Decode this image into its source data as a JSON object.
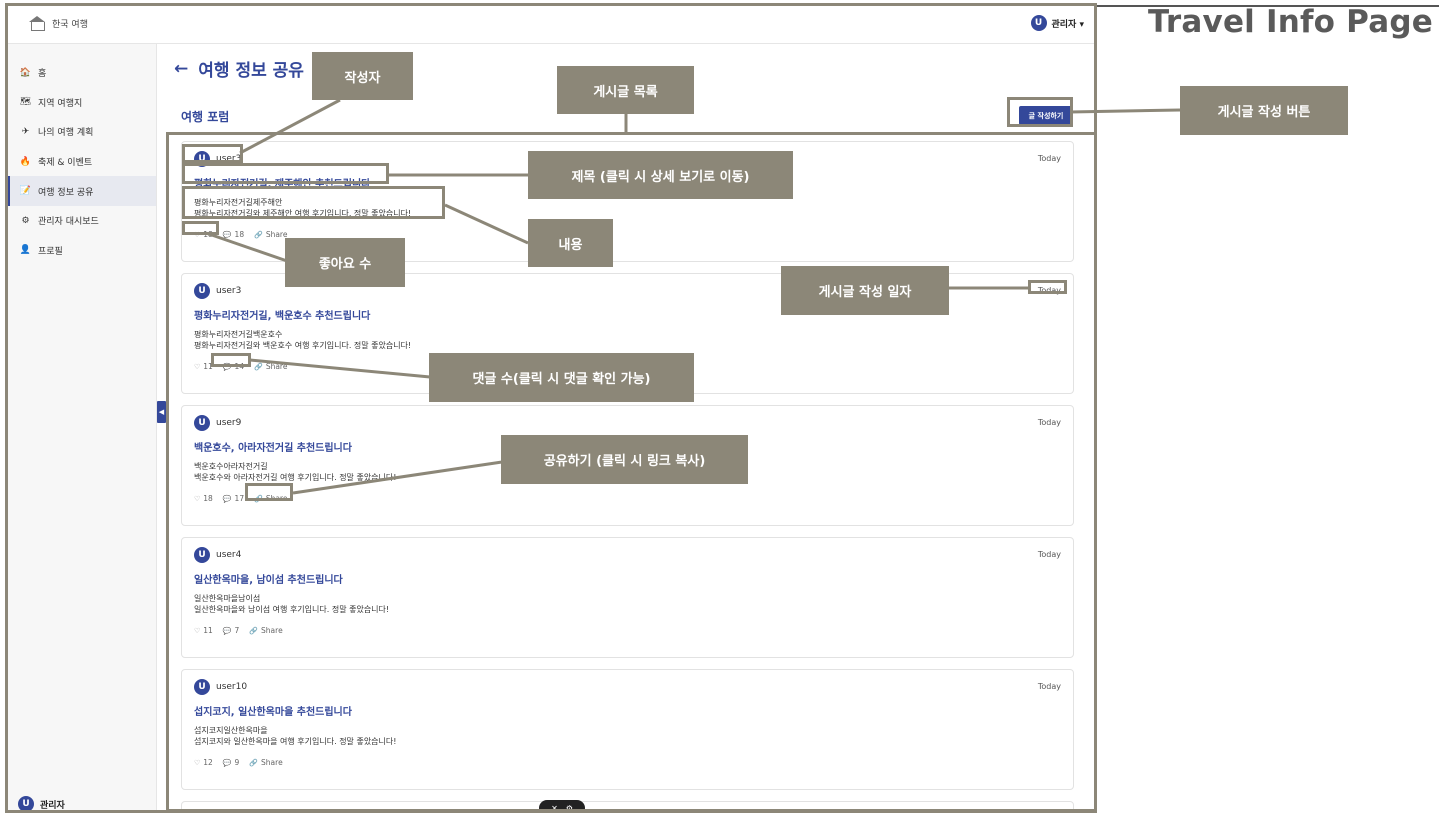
{
  "page_heading": "Travel Info Page",
  "brand": {
    "name": "한국 여행"
  },
  "user_menu": {
    "avatar_letter": "U",
    "name": "관리자 ▾"
  },
  "sidebar": {
    "items": [
      {
        "label": "홈",
        "icon": "home-icon",
        "glyph": "🏠"
      },
      {
        "label": "지역 여행지",
        "icon": "map-icon",
        "glyph": "🗺"
      },
      {
        "label": "나의 여행 계획",
        "icon": "plane-icon",
        "glyph": "✈"
      },
      {
        "label": "축제 & 이벤트",
        "icon": "fire-icon",
        "glyph": "🔥"
      },
      {
        "label": "여행 정보 공유",
        "icon": "note-icon",
        "glyph": "📝"
      },
      {
        "label": "관리자 대시보드",
        "icon": "gear-icon",
        "glyph": "⚙"
      },
      {
        "label": "프로필",
        "icon": "person-icon",
        "glyph": "👤"
      }
    ],
    "active_index": 4,
    "footer_user": {
      "avatar_letter": "U",
      "name": "관리자"
    }
  },
  "main": {
    "back_symbol": "←",
    "title": "여행 정보 공유",
    "forum_title": "여행 포럼",
    "write_button": "글 작성하기"
  },
  "posts": [
    {
      "avatar_letter": "U",
      "author": "user3",
      "date": "Today",
      "title": "평화누리자전거길, 제주해안 추천드립니다",
      "subtitle": "평화누리자전거길제주해안",
      "body": "평화누리자전거길와 제주해안 여행 후기입니다. 정말 좋았습니다!",
      "likes": "18",
      "comments": "18",
      "share": "Share"
    },
    {
      "avatar_letter": "U",
      "author": "user3",
      "date": "Today",
      "title": "평화누리자전거길, 백운호수 추천드립니다",
      "subtitle": "평화누리자전거길백운호수",
      "body": "평화누리자전거길와 백운호수 여행 후기입니다. 정말 좋았습니다!",
      "likes": "11",
      "comments": "14",
      "share": "Share"
    },
    {
      "avatar_letter": "U",
      "author": "user9",
      "date": "Today",
      "title": "백운호수, 아라자전거길 추천드립니다",
      "subtitle": "백운호수아라자전거길",
      "body": "백운호수와 아라자전거길 여행 후기입니다. 정말 좋았습니다!",
      "likes": "18",
      "comments": "17",
      "share": "Share"
    },
    {
      "avatar_letter": "U",
      "author": "user4",
      "date": "Today",
      "title": "일산한옥마을, 남이섬 추천드립니다",
      "subtitle": "일산한옥마을남이섬",
      "body": "일산한옥마을와 남이섬 여행 후기입니다. 정말 좋았습니다!",
      "likes": "11",
      "comments": "7",
      "share": "Share"
    },
    {
      "avatar_letter": "U",
      "author": "user10",
      "date": "Today",
      "title": "섭지코지, 일산한옥마을 추천드립니다",
      "subtitle": "섭지코지일산한옥마을",
      "body": "섭지코지와 일산한옥마을 여행 후기입니다. 정말 좋았습니다!",
      "likes": "12",
      "comments": "9",
      "share": "Share"
    }
  ],
  "annotations": {
    "author": "작성자",
    "post_list": "게시글 목록",
    "write_button": "게시글 작성 버튼",
    "title": "제목 (클릭 시 상세 보기로 이동)",
    "content": "내용",
    "likes": "좋아요 수",
    "date": "게시글 작성 일자",
    "comments": "댓글 수(클릭 시 댓글 확인 가능)",
    "share": "공유하기 (클릭 시 링크 복사)"
  },
  "colors": {
    "accent": "#34489a",
    "annotation": "#8c8778"
  }
}
